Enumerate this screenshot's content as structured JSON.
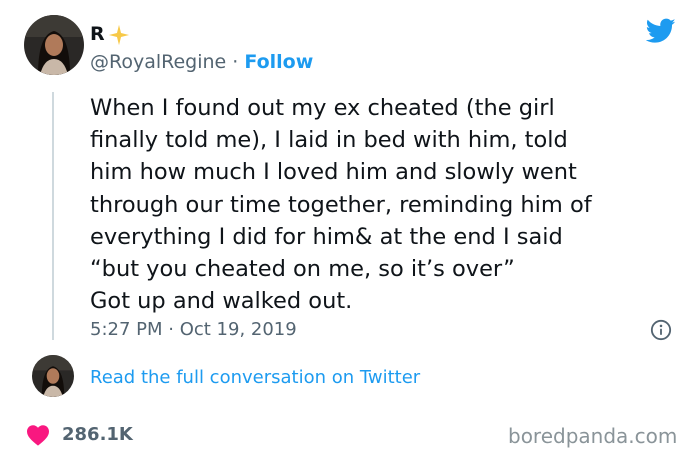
{
  "author": {
    "name": "R",
    "handle": "@RoyalRegine",
    "separator": " · ",
    "follow_label": "Follow"
  },
  "tweet": {
    "lines": [
      "When I found out my ex cheated (the girl",
      "finally told me), I laid in bed with him, told",
      "him how much I loved him and slowly went",
      "through our time together, reminding him of",
      "everything I did for him& at the end I said",
      "“but you cheated on me, so it’s over”",
      "Got up and walked out."
    ],
    "timestamp": "5:27 PM · Oct 19, 2019"
  },
  "conversation_link": "Read the full conversation on Twitter",
  "engagement": {
    "likes": "286.1K"
  },
  "watermark": "boredpanda.com",
  "colors": {
    "accent": "#1d9bf0",
    "heart": "#f91880",
    "secondary_text": "#536471",
    "sparkle": "#f7c948"
  },
  "icons": [
    "avatar",
    "sparkle-icon",
    "twitter-bird-icon",
    "info-icon",
    "heart-icon"
  ]
}
